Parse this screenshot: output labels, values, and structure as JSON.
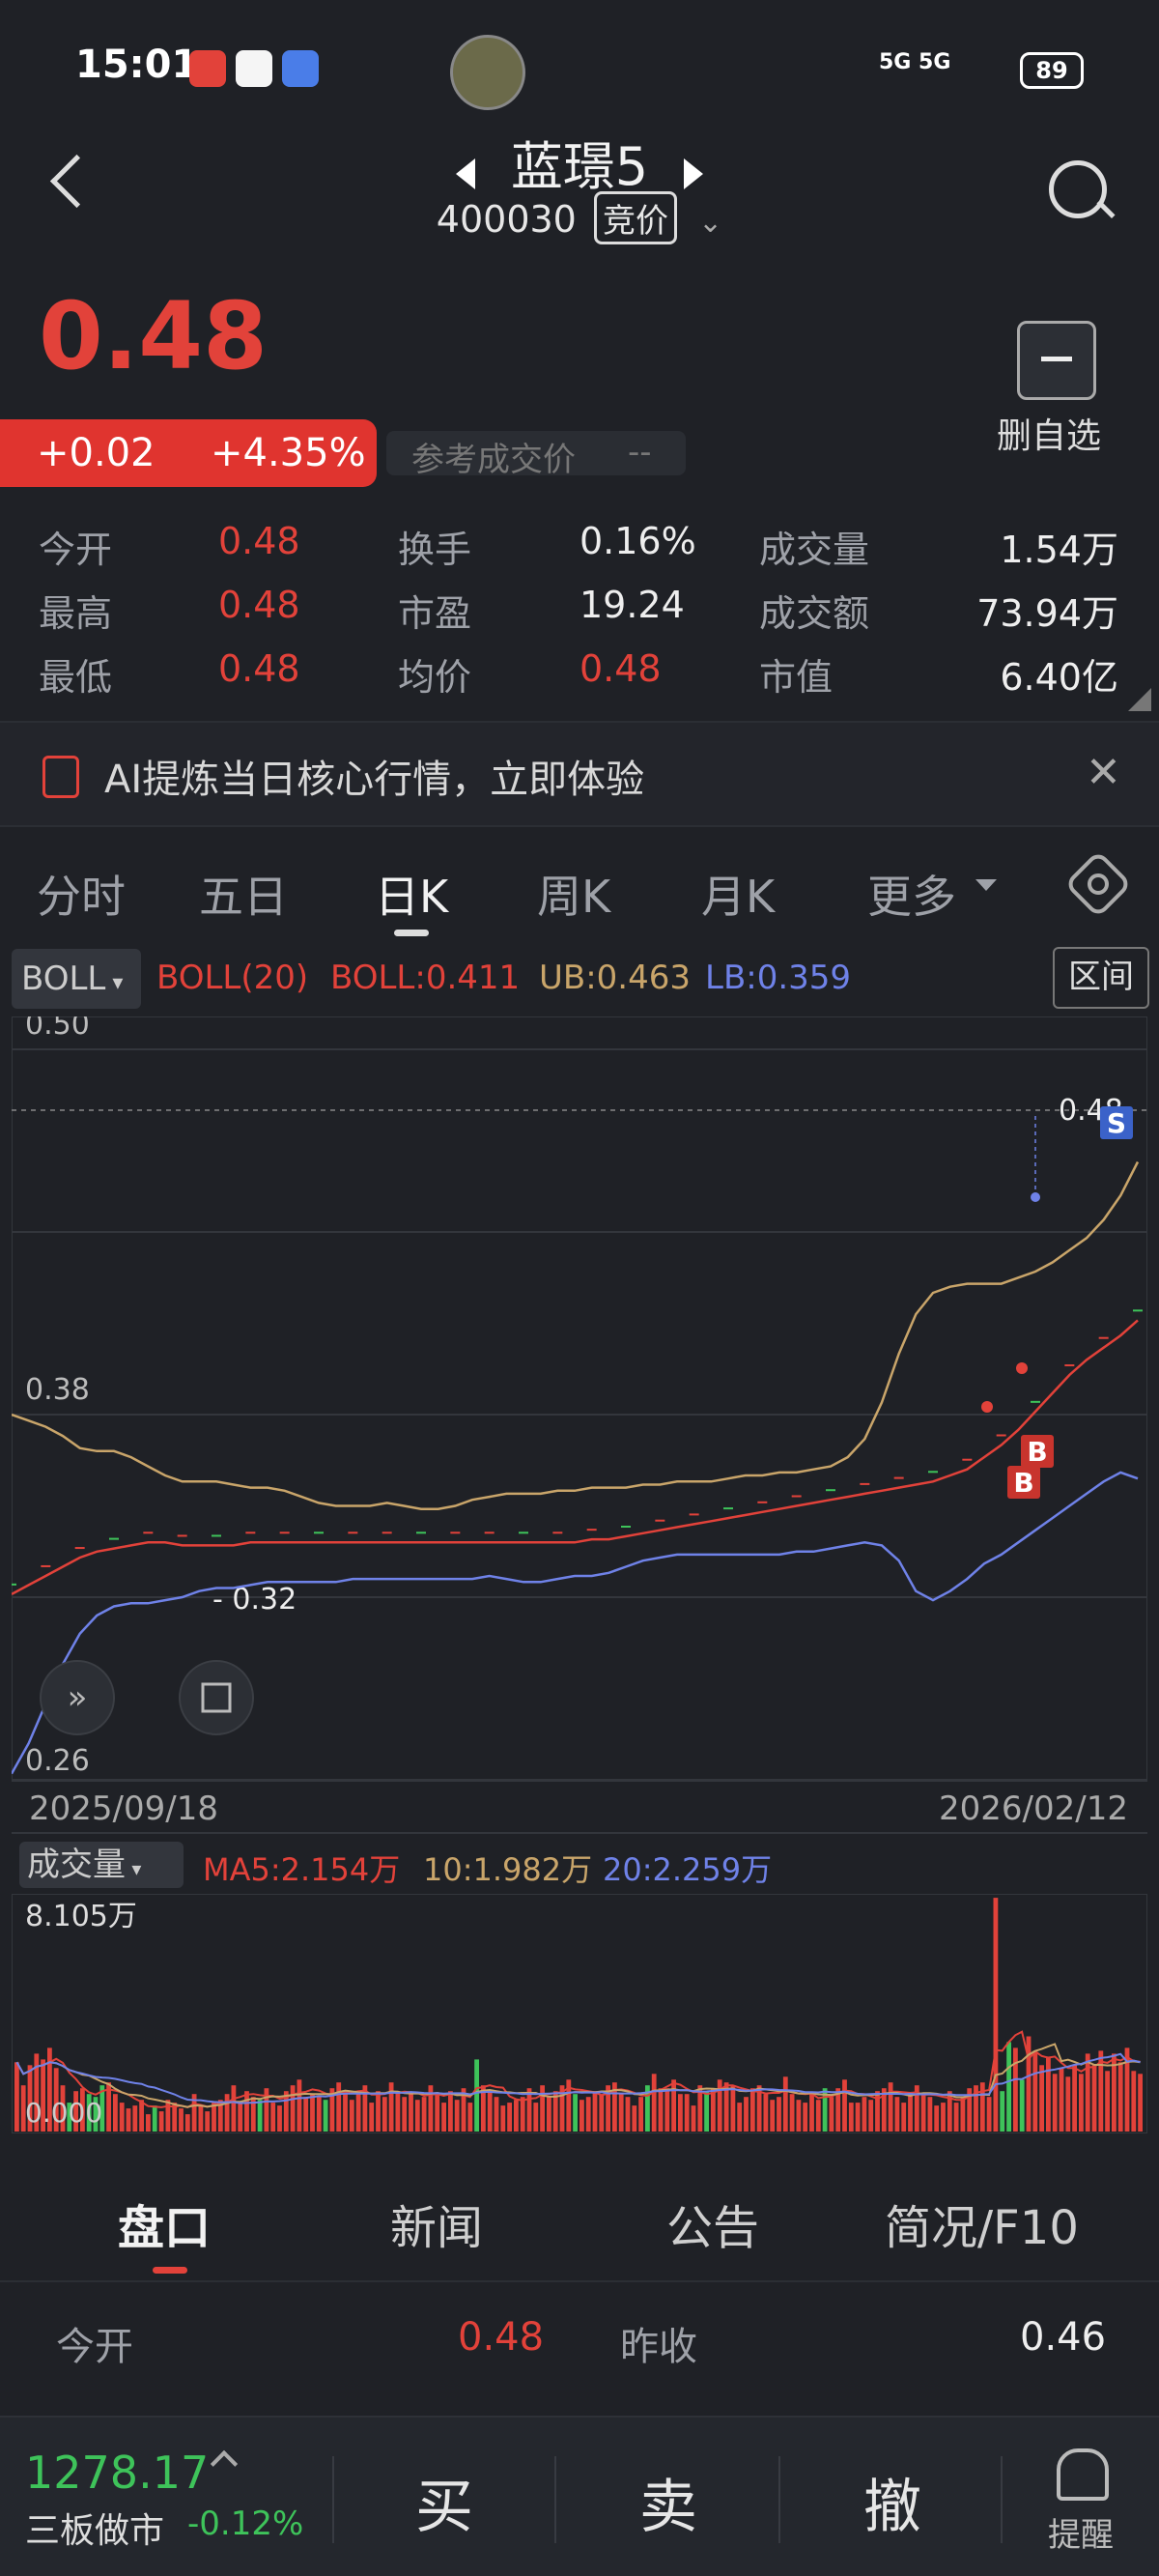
{
  "status_bar": {
    "time": "15:01",
    "network": "5G 5G",
    "battery": "89"
  },
  "header": {
    "stock_name": "蓝璟5",
    "stock_code": "400030",
    "bid_tag": "竞价"
  },
  "price": {
    "current": "0.48",
    "change_abs": "+0.02",
    "change_pct": "+4.35%",
    "ref_label": "参考成交价",
    "ref_value": "--"
  },
  "favorite": {
    "label": "删自选"
  },
  "stats": [
    {
      "label": "今开",
      "value": "0.48",
      "color": "red"
    },
    {
      "label": "换手",
      "value": "0.16%",
      "color": "white"
    },
    {
      "label": "成交量",
      "value": "1.54万",
      "color": "white"
    },
    {
      "label": "最高",
      "value": "0.48",
      "color": "red"
    },
    {
      "label": "市盈",
      "value": "19.24",
      "color": "white"
    },
    {
      "label": "成交额",
      "value": "73.94万",
      "color": "white"
    },
    {
      "label": "最低",
      "value": "0.48",
      "color": "red"
    },
    {
      "label": "均价",
      "value": "0.48",
      "color": "red"
    },
    {
      "label": "市值",
      "value": "6.40亿",
      "color": "white"
    }
  ],
  "ai_banner": {
    "text": "AI提炼当日核心行情，立即体验",
    "close": "✕"
  },
  "chart_tabs": [
    "分时",
    "五日",
    "日K",
    "周K",
    "月K",
    "更多"
  ],
  "active_chart_tab": "日K",
  "indicator": {
    "selector": "BOLL",
    "name": "BOLL(20)",
    "boll": "BOLL:0.411",
    "ub": "UB:0.463",
    "lb": "LB:0.359",
    "interval_button": "区间"
  },
  "colors": {
    "red": "#e2423a",
    "green": "#3ec35a",
    "mid": "#e2423a",
    "ub": "#c9a56a",
    "lb": "#6f82e8"
  },
  "chart_data": {
    "type": "line",
    "x_start": "2025/09/18",
    "x_end": "2026/02/12",
    "y_ticks": [
      "0.50",
      "0.38",
      "0.26"
    ],
    "ylim": [
      0.26,
      0.5
    ],
    "last_price_label": "0.48",
    "min_label": "0.32",
    "markers": [
      "B",
      "B",
      "S"
    ],
    "series": [
      {
        "name": "BOLL",
        "values": [
          0.321,
          0.324,
          0.327,
          0.33,
          0.333,
          0.335,
          0.336,
          0.337,
          0.338,
          0.338,
          0.337,
          0.337,
          0.337,
          0.337,
          0.338,
          0.338,
          0.338,
          0.338,
          0.338,
          0.338,
          0.338,
          0.338,
          0.338,
          0.338,
          0.338,
          0.338,
          0.338,
          0.338,
          0.338,
          0.338,
          0.338,
          0.338,
          0.338,
          0.338,
          0.339,
          0.339,
          0.34,
          0.341,
          0.342,
          0.343,
          0.344,
          0.345,
          0.346,
          0.347,
          0.348,
          0.349,
          0.35,
          0.351,
          0.352,
          0.353,
          0.354,
          0.355,
          0.356,
          0.357,
          0.358,
          0.36,
          0.362,
          0.366,
          0.37,
          0.375,
          0.381,
          0.387,
          0.393,
          0.398,
          0.402,
          0.406,
          0.411
        ]
      },
      {
        "name": "UB",
        "values": [
          0.38,
          0.378,
          0.376,
          0.373,
          0.369,
          0.368,
          0.368,
          0.366,
          0.363,
          0.36,
          0.358,
          0.358,
          0.358,
          0.357,
          0.356,
          0.356,
          0.355,
          0.353,
          0.351,
          0.35,
          0.35,
          0.35,
          0.351,
          0.35,
          0.349,
          0.349,
          0.35,
          0.352,
          0.353,
          0.354,
          0.354,
          0.354,
          0.355,
          0.355,
          0.356,
          0.356,
          0.356,
          0.357,
          0.357,
          0.358,
          0.358,
          0.358,
          0.359,
          0.36,
          0.36,
          0.361,
          0.361,
          0.362,
          0.363,
          0.366,
          0.372,
          0.384,
          0.4,
          0.413,
          0.42,
          0.422,
          0.423,
          0.423,
          0.423,
          0.425,
          0.427,
          0.43,
          0.434,
          0.438,
          0.444,
          0.452,
          0.463
        ]
      },
      {
        "name": "LB",
        "values": [
          0.262,
          0.272,
          0.285,
          0.298,
          0.308,
          0.314,
          0.317,
          0.318,
          0.318,
          0.319,
          0.32,
          0.322,
          0.323,
          0.323,
          0.324,
          0.325,
          0.325,
          0.325,
          0.325,
          0.325,
          0.326,
          0.326,
          0.326,
          0.326,
          0.326,
          0.326,
          0.326,
          0.326,
          0.327,
          0.326,
          0.325,
          0.325,
          0.326,
          0.327,
          0.327,
          0.328,
          0.33,
          0.332,
          0.333,
          0.334,
          0.334,
          0.334,
          0.334,
          0.334,
          0.334,
          0.334,
          0.335,
          0.335,
          0.336,
          0.337,
          0.338,
          0.337,
          0.332,
          0.322,
          0.319,
          0.322,
          0.326,
          0.331,
          0.334,
          0.338,
          0.342,
          0.346,
          0.35,
          0.354,
          0.358,
          0.361,
          0.359
        ]
      }
    ]
  },
  "volume": {
    "selector": "成交量",
    "ma5": "MA5:2.154万",
    "ma10": "10:1.982万",
    "ma20": "20:2.259万",
    "max_label": "8.105万",
    "min_label": "0.000",
    "values": [
      2.4,
      1.6,
      2.3,
      2.7,
      2.5,
      2.9,
      2.2,
      1.6,
      1.0,
      1.4,
      1.5,
      1.3,
      1.2,
      1.6,
      1.7,
      1.3,
      1.0,
      0.8,
      0.9,
      1.1,
      0.6,
      0.9,
      0.7,
      1.1,
      1.0,
      0.8,
      0.6,
      1.3,
      0.9,
      0.7,
      1.0,
      1.1,
      1.3,
      1.6,
      1.0,
      1.4,
      1.2,
      1.1,
      1.5,
      1.0,
      0.9,
      1.4,
      1.6,
      1.8,
      1.2,
      1.3,
      1.2,
      1.1,
      1.5,
      1.7,
      1.4,
      1.1,
      1.3,
      1.6,
      1.0,
      1.4,
      1.2,
      1.7,
      1.4,
      1.2,
      1.3,
      1.1,
      1.2,
      1.6,
      1.3,
      1.0,
      1.4,
      1.1,
      1.5,
      1.0,
      2.5,
      1.6,
      1.4,
      1.2,
      0.9,
      1.0,
      1.1,
      1.2,
      1.5,
      1.0,
      1.6,
      1.2,
      1.4,
      1.6,
      1.8,
      1.3,
      1.1,
      1.2,
      1.4,
      1.3,
      1.6,
      1.7,
      1.3,
      1.2,
      0.9,
      1.2,
      1.6,
      2.0,
      1.5,
      1.5,
      1.8,
      1.3,
      1.3,
      0.9,
      1.6,
      1.4,
      1.5,
      1.8,
      1.7,
      1.6,
      1.0,
      1.2,
      1.5,
      1.6,
      1.3,
      1.1,
      1.2,
      1.9,
      1.3,
      1.1,
      1.0,
      1.3,
      1.1,
      1.5,
      1.2,
      1.5,
      1.8,
      1.0,
      1.0,
      1.2,
      1.1,
      1.4,
      1.5,
      1.7,
      1.2,
      1.0,
      1.3,
      1.6,
      1.3,
      1.2,
      0.9,
      1.0,
      1.4,
      1.0,
      1.2,
      1.5,
      1.6,
      1.7,
      1.2,
      8.1,
      1.4,
      3.1,
      2.9,
      1.8,
      3.3,
      2.8,
      2.3,
      2.6,
      2.0,
      2.2,
      1.9,
      2.3,
      2.0,
      2.7,
      2.3,
      2.8,
      2.1,
      2.7,
      2.4,
      2.9,
      2.1,
      2.0
    ],
    "up": [
      1,
      1,
      1,
      1,
      1,
      1,
      1,
      1,
      0,
      1,
      1,
      0,
      0,
      0,
      1,
      1,
      1,
      1,
      1,
      1,
      1,
      0,
      1,
      1,
      1,
      1,
      1,
      1,
      1,
      1,
      1,
      1,
      1,
      1,
      1,
      1,
      1,
      0,
      1,
      1,
      1,
      1,
      1,
      1,
      1,
      1,
      1,
      0,
      1,
      1,
      1,
      1,
      1,
      1,
      1,
      1,
      1,
      1,
      1,
      1,
      1,
      1,
      1,
      1,
      1,
      1,
      1,
      1,
      1,
      1,
      0,
      1,
      1,
      1,
      1,
      1,
      1,
      1,
      1,
      1,
      1,
      1,
      1,
      1,
      1,
      0,
      1,
      1,
      1,
      1,
      1,
      1,
      1,
      1,
      1,
      1,
      0,
      1,
      1,
      1,
      1,
      1,
      1,
      1,
      1,
      0,
      1,
      1,
      1,
      1,
      1,
      1,
      1,
      1,
      1,
      1,
      1,
      1,
      1,
      1,
      1,
      1,
      1,
      0,
      1,
      1,
      1,
      1,
      1,
      1,
      1,
      1,
      1,
      1,
      1,
      1,
      1,
      1,
      1,
      1,
      1,
      1,
      1,
      1,
      1,
      1,
      1,
      1,
      1,
      1,
      0,
      0,
      1,
      0,
      1,
      1,
      1,
      1,
      1,
      1,
      1,
      1,
      1,
      1,
      1,
      1,
      1,
      1,
      1,
      1,
      1,
      1,
      1,
      1,
      1,
      1
    ]
  },
  "bottom_tabs": [
    "盘口",
    "新闻",
    "公告",
    "简况/F10"
  ],
  "quote_rows": {
    "open_label": "今开",
    "open_value": "0.48",
    "prev_label": "昨收",
    "prev_value": "0.46"
  },
  "bottom_bar": {
    "index_value": "1278.17",
    "index_name": "三板做市",
    "index_pct": "-0.12%",
    "buy": "买",
    "sell": "卖",
    "cancel": "撤",
    "alert": "提醒"
  }
}
